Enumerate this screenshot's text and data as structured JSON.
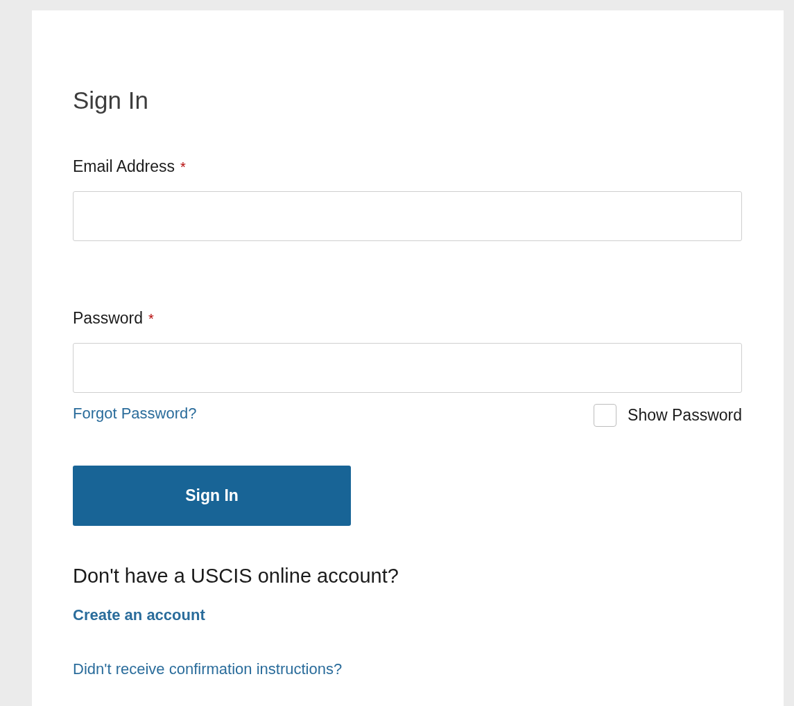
{
  "title": "Sign In",
  "fields": [
    {
      "label": "Email Address",
      "required_mark": "*"
    },
    {
      "label": "Password",
      "required_mark": "*"
    }
  ],
  "forgot_link": "Forgot Password?",
  "show_password": {
    "label": "Show Password",
    "checked": false
  },
  "submit_button": "Sign In",
  "account_prompt": "Don't have a USCIS online account?",
  "create_link": "Create an account",
  "confirmation_link": "Didn't receive confirmation instructions?"
}
